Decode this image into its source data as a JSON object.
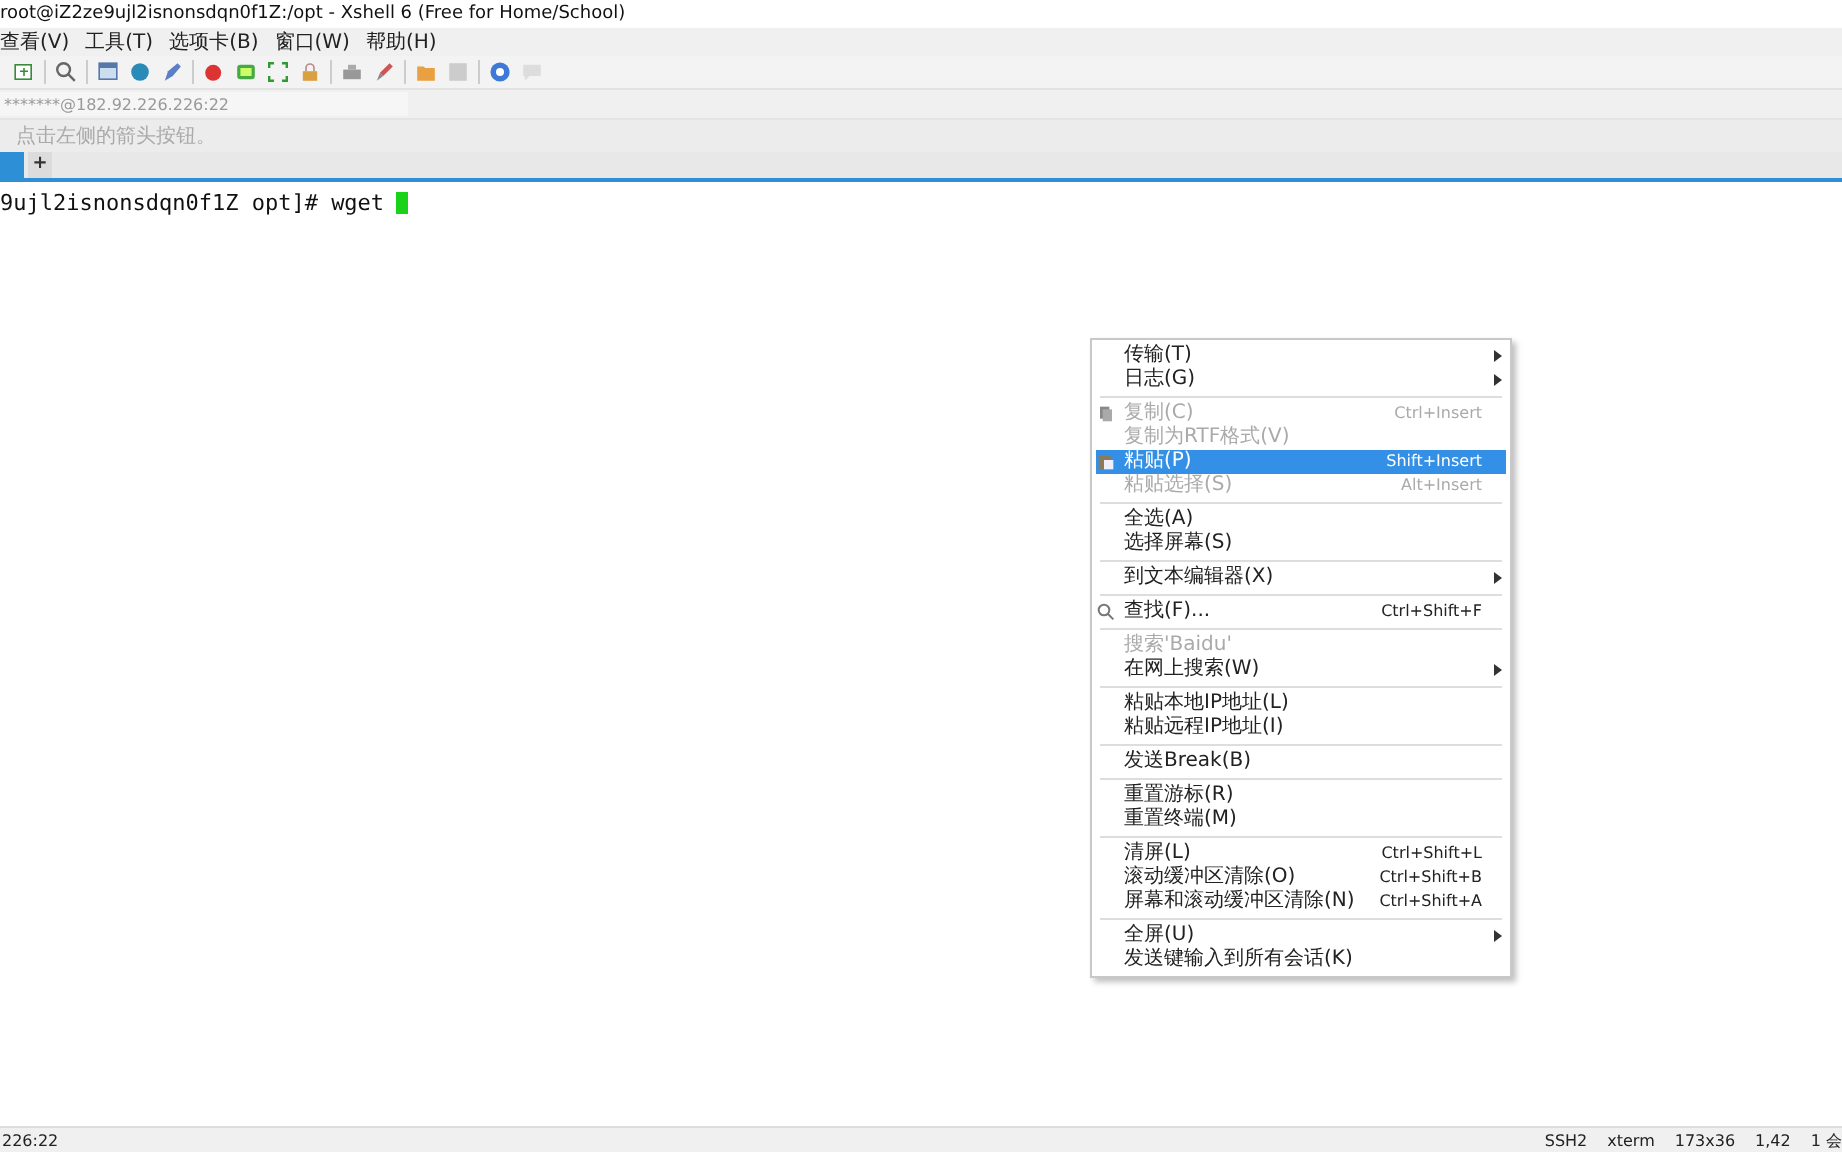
{
  "window": {
    "title": "root@iZ2ze9ujl2isnonsdqn0f1Z:/opt - Xshell 6 (Free for Home/School)"
  },
  "menubar": [
    {
      "label": "查看(V)"
    },
    {
      "label": "工具(T)"
    },
    {
      "label": "选项卡(B)"
    },
    {
      "label": "窗口(W)"
    },
    {
      "label": "帮助(H)"
    }
  ],
  "address": {
    "value": "*******@182.92.226.226:22"
  },
  "hint": "点击左侧的箭头按钮。",
  "tabs": [
    {
      "selected": true
    },
    {
      "label": "+",
      "selected": false
    }
  ],
  "terminal": {
    "prompt": "9ujl2isnonsdqn0f1Z opt]# wget"
  },
  "context_menu": [
    {
      "kind": "item",
      "label": "传输(T)",
      "submenu": true,
      "disabled": false,
      "selected": false
    },
    {
      "kind": "item",
      "label": "日志(G)",
      "submenu": true,
      "disabled": false,
      "selected": false
    },
    {
      "kind": "separator"
    },
    {
      "kind": "item",
      "label": "复制(C)",
      "shortcut": "Ctrl+Insert",
      "disabled": true,
      "selected": false
    },
    {
      "kind": "item",
      "label": "复制为RTF格式(V)",
      "disabled": true,
      "selected": false
    },
    {
      "kind": "item",
      "label": "粘贴(P)",
      "shortcut": "Shift+Insert",
      "disabled": false,
      "selected": true
    },
    {
      "kind": "item",
      "label": "粘贴选择(S)",
      "shortcut": "Alt+Insert",
      "disabled": true,
      "selected": false
    },
    {
      "kind": "separator"
    },
    {
      "kind": "item",
      "label": "全选(A)",
      "disabled": false,
      "selected": false
    },
    {
      "kind": "item",
      "label": "选择屏幕(S)",
      "disabled": false,
      "selected": false
    },
    {
      "kind": "separator"
    },
    {
      "kind": "item",
      "label": "到文本编辑器(X)",
      "submenu": true,
      "disabled": false,
      "selected": false
    },
    {
      "kind": "separator"
    },
    {
      "kind": "item",
      "label": "查找(F)...",
      "shortcut": "Ctrl+Shift+F",
      "disabled": false,
      "selected": false
    },
    {
      "kind": "separator"
    },
    {
      "kind": "item",
      "label": "搜索'Baidu'",
      "disabled": true,
      "selected": false
    },
    {
      "kind": "item",
      "label": "在网上搜索(W)",
      "submenu": true,
      "disabled": false,
      "selected": false
    },
    {
      "kind": "separator"
    },
    {
      "kind": "item",
      "label": "粘贴本地IP地址(L)",
      "disabled": false,
      "selected": false
    },
    {
      "kind": "item",
      "label": "粘贴远程IP地址(I)",
      "disabled": false,
      "selected": false
    },
    {
      "kind": "separator"
    },
    {
      "kind": "item",
      "label": "发送Break(B)",
      "disabled": false,
      "selected": false
    },
    {
      "kind": "separator"
    },
    {
      "kind": "item",
      "label": "重置游标(R)",
      "disabled": false,
      "selected": false
    },
    {
      "kind": "item",
      "label": "重置终端(M)",
      "disabled": false,
      "selected": false
    },
    {
      "kind": "separator"
    },
    {
      "kind": "item",
      "label": "清屏(L)",
      "shortcut": "Ctrl+Shift+L",
      "disabled": false,
      "selected": false
    },
    {
      "kind": "item",
      "label": "滚动缓冲区清除(O)",
      "shortcut": "Ctrl+Shift+B",
      "disabled": false,
      "selected": false
    },
    {
      "kind": "item",
      "label": "屏幕和滚动缓冲区清除(N)",
      "shortcut": "Ctrl+Shift+A",
      "disabled": false,
      "selected": false
    },
    {
      "kind": "separator"
    },
    {
      "kind": "item",
      "label": "全屏(U)",
      "submenu": true,
      "disabled": false,
      "selected": false
    },
    {
      "kind": "item",
      "label": "发送键输入到所有会话(K)",
      "disabled": false,
      "selected": false
    }
  ],
  "status_bar": {
    "left": "226:22",
    "items": [
      "SSH2",
      "xterm",
      "173x36",
      "1,42",
      "1 会"
    ]
  }
}
